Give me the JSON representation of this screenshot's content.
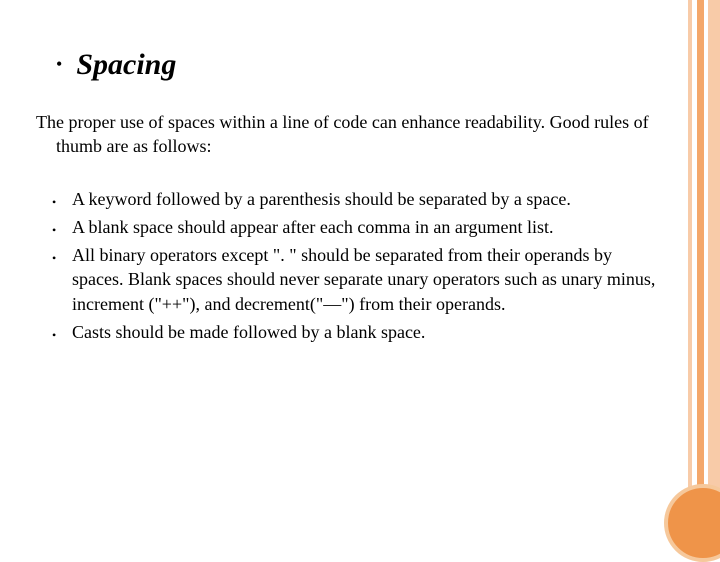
{
  "title": "Spacing",
  "intro_line": "The proper use of spaces within a line of code can enhance readability. Good rules of thumb are as follows:",
  "bullets": [
    "A keyword followed by a parenthesis should be separated by a space.",
    "A blank space should appear after each comma in an argument list.",
    "All binary operators except \". \" should be separated from their operands by spaces. Blank spaces should never separate unary operators such as unary minus, increment (\"++\"), and decrement(\"—\") from their operands.",
    " Casts should be made followed by a blank space."
  ]
}
